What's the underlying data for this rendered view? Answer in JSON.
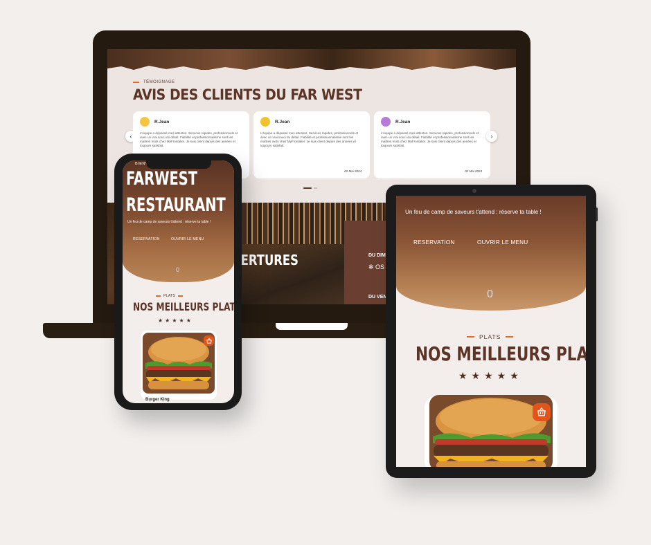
{
  "laptop": {
    "kicker": "TÉMOIGNAGE",
    "title": "AVIS DES CLIENTS DU FAR WEST",
    "prev_arrow": "‹",
    "next_arrow": "›",
    "reviews": [
      {
        "name": "R.Jean",
        "text": "L'équipe a dépassé mes attentes. Services rapides, professionnels et avec un vrai souci du détail. Fiabilité et professionnalisme sont les maîtres mots chez MyFrontalier. Je suis client depuis des années et toujours satisfait.",
        "date": "",
        "avatar_color": "#f4c542"
      },
      {
        "name": "R.Jean",
        "text": "L'équipe a dépassé mes attentes. Services rapides, professionnels et avec un vrai souci du détail. Fiabilité et professionnalisme sont les maîtres mots chez MyFrontalier. Je suis client depuis des années et toujours satisfait.",
        "date": "02 Mai 2024",
        "avatar_color": "#f2c12e"
      },
      {
        "name": "R.Jean",
        "text": "L'équipe a dépassé mes attentes. Services rapides, professionnels et avec un vrai souci du détail. Fiabilité et professionnalisme sont les maîtres mots chez MyFrontalier. Je suis client depuis des années et toujours satisfait.",
        "date": "02 Mai 2024",
        "avatar_color": "#b77bd6"
      }
    ],
    "openings_title": "VERTURES",
    "hours_line1": "DU DIMA",
    "hours_line2": "✻  OS",
    "hours_line3": "DU VEN"
  },
  "phone": {
    "kicker": "BIENV",
    "title_line1": "FARWEST",
    "title_line2": "RESTAURANT",
    "tagline": "Un feu de camp de saveurs t'attend : réserve ta table !",
    "btn_reservation": "RESERVATION",
    "btn_menu": "OUVRIR LE MENU",
    "scroll_indicator": "0",
    "plats_kicker": "PLATS",
    "plats_title": "NOS MEILLEURS PLATS",
    "stars": "★★★★★",
    "dish_name": "Burger King"
  },
  "tablet": {
    "tagline": "Un feu de camp de saveurs t'attend : réserve ta table !",
    "btn_reservation": "RESERVATION",
    "btn_menu": "OUVRIR LE MENU",
    "scroll_indicator": "0",
    "plats_kicker": "PLATS",
    "plats_title": "NOS MEILLEURS PLATS",
    "stars": "★★★★★"
  },
  "colors": {
    "brand_brown": "#5c3426",
    "accent_orange": "#e06a2a",
    "cart_orange": "#e1541c",
    "background": "#f2efed"
  }
}
